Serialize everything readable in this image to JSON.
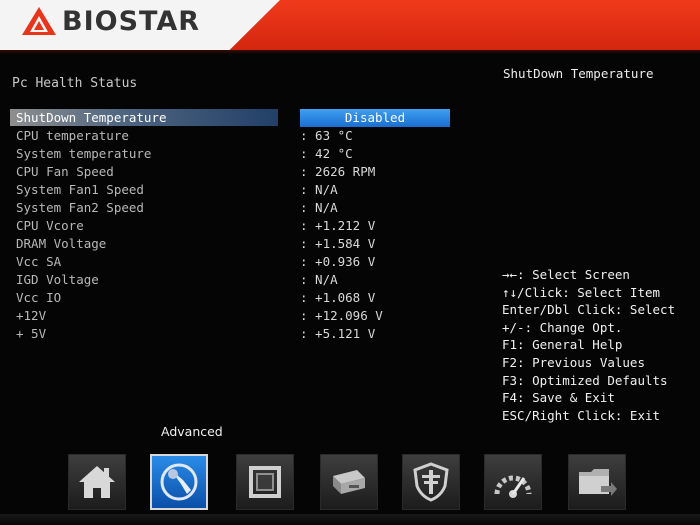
{
  "header": {
    "brand": "BIOSTAR"
  },
  "main": {
    "section_title": "Pc Health Status",
    "selected_value": "Disabled",
    "rows": [
      {
        "label": "ShutDown Temperature",
        "value": ""
      },
      {
        "label": "CPU temperature",
        "value": ": 63 °C"
      },
      {
        "label": "System temperature",
        "value": ": 42 °C"
      },
      {
        "label": "CPU Fan Speed",
        "value": ": 2626 RPM"
      },
      {
        "label": "System Fan1 Speed",
        "value": ": N/A"
      },
      {
        "label": "System Fan2 Speed",
        "value": ": N/A"
      },
      {
        "label": "CPU Vcore",
        "value": ": +1.212 V"
      },
      {
        "label": "DRAM Voltage",
        "value": ": +1.584 V"
      },
      {
        "label": "Vcc SA",
        "value": ": +0.936 V"
      },
      {
        "label": "IGD Voltage",
        "value": ": N/A"
      },
      {
        "label": "Vcc IO",
        "value": ": +1.068 V"
      },
      {
        "label": "+12V",
        "value": ": +12.096 V"
      },
      {
        "label": "+ 5V",
        "value": ": +5.121 V"
      }
    ]
  },
  "help": {
    "title": "ShutDown Temperature",
    "keys": [
      "→←: Select Screen",
      "↑↓/Click: Select Item",
      "Enter/Dbl Click: Select",
      "+/-: Change Opt.",
      "F1: General Help",
      "F2: Previous Values",
      "F3: Optimized Defaults",
      "F4: Save & Exit",
      "ESC/Right Click: Exit"
    ]
  },
  "nav": {
    "active_label": "Advanced",
    "items": [
      {
        "icon": "home-icon"
      },
      {
        "icon": "advanced-icon"
      },
      {
        "icon": "chipset-icon"
      },
      {
        "icon": "boot-drive-icon"
      },
      {
        "icon": "security-shield-icon"
      },
      {
        "icon": "performance-gauge-icon"
      },
      {
        "icon": "save-exit-icon"
      }
    ]
  },
  "colors": {
    "header_red": "#e8341a",
    "selection_blue": "#2a8ce8",
    "background": "#050505"
  }
}
